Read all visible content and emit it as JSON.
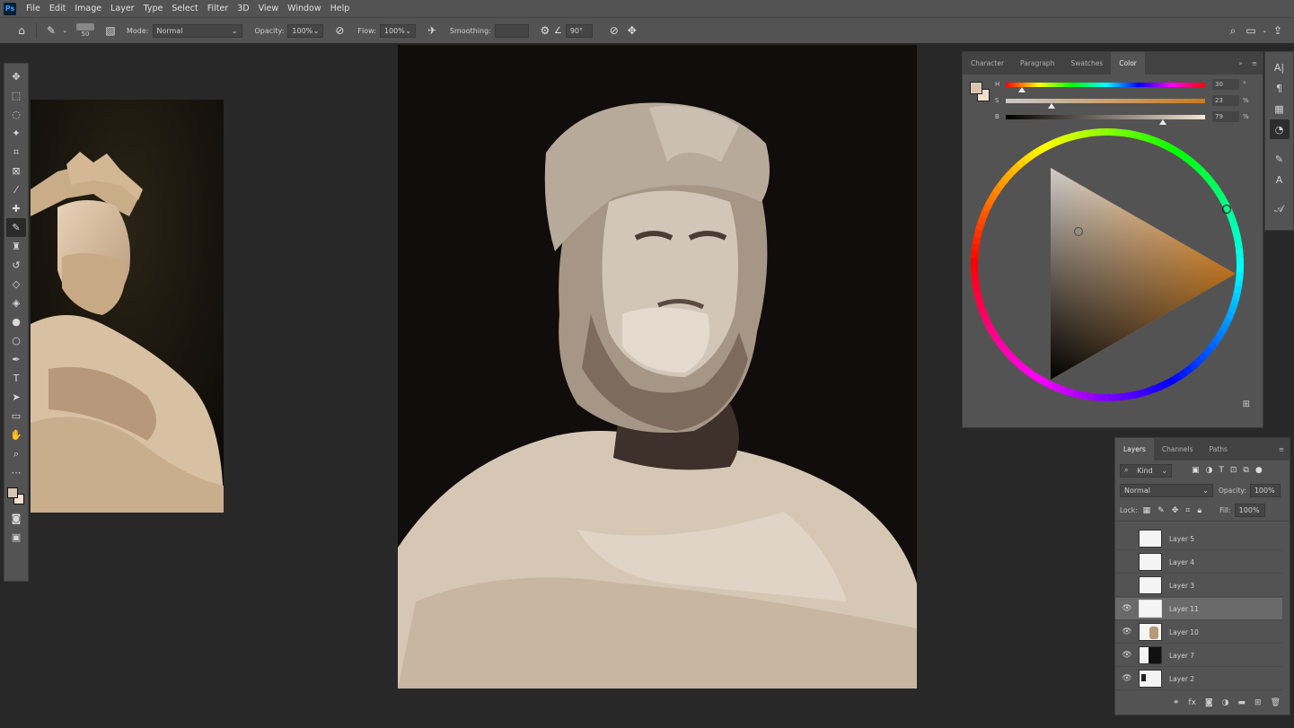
{
  "app": {
    "logo": "Ps"
  },
  "menu": [
    "File",
    "Edit",
    "Image",
    "Layer",
    "Type",
    "Select",
    "Filter",
    "3D",
    "View",
    "Window",
    "Help"
  ],
  "options_bar": {
    "brush_size": "50",
    "mode_label": "Mode:",
    "mode_value": "Normal",
    "opacity_label": "Opacity:",
    "opacity_value": "100%",
    "flow_label": "Flow:",
    "flow_value": "100%",
    "smoothing_label": "Smoothing:",
    "angle_value": "90°"
  },
  "color_panel": {
    "tabs": [
      "Character",
      "Paragraph",
      "Swatches",
      "Color"
    ],
    "active_tab": "Color",
    "foreground": "#d9c6b2",
    "background": "#f3e0cc",
    "hsb": {
      "h": {
        "label": "H",
        "value": "30",
        "unit": "°",
        "fraction": 0.08
      },
      "s": {
        "label": "S",
        "value": "23",
        "unit": "%",
        "fraction": 0.23
      },
      "b": {
        "label": "B",
        "value": "79",
        "unit": "%",
        "fraction": 0.79
      }
    }
  },
  "layers_panel": {
    "tabs": [
      "Layers",
      "Channels",
      "Paths"
    ],
    "active_tab": "Layers",
    "filter_label": "Kind",
    "blend_mode": "Normal",
    "opacity_label": "Opacity:",
    "opacity_value": "100%",
    "lock_label": "Lock:",
    "fill_label": "Fill:",
    "fill_value": "100%",
    "layers": [
      {
        "name": "Layer 5",
        "visible": false,
        "selected": false
      },
      {
        "name": "Layer 4",
        "visible": false,
        "selected": false
      },
      {
        "name": "Layer 3",
        "visible": false,
        "selected": false
      },
      {
        "name": "Layer 11",
        "visible": true,
        "selected": true
      },
      {
        "name": "Layer 10",
        "visible": true,
        "selected": false
      },
      {
        "name": "Layer 7",
        "visible": true,
        "selected": false
      },
      {
        "name": "Layer 2",
        "visible": true,
        "selected": false
      }
    ]
  },
  "tools": [
    "move-icon",
    "marquee-icon",
    "lasso-icon",
    "magic-wand-icon",
    "crop-icon",
    "frame-icon",
    "eyedropper-icon",
    "healing-icon",
    "brush-icon",
    "stamp-icon",
    "history-brush-icon",
    "eraser-icon",
    "paint-bucket-icon",
    "blur-icon",
    "dodge-icon",
    "pen-icon",
    "type-icon",
    "path-select-icon",
    "rectangle-icon",
    "hand-icon",
    "zoom-icon",
    "more-icon"
  ],
  "active_tool": "brush-icon"
}
